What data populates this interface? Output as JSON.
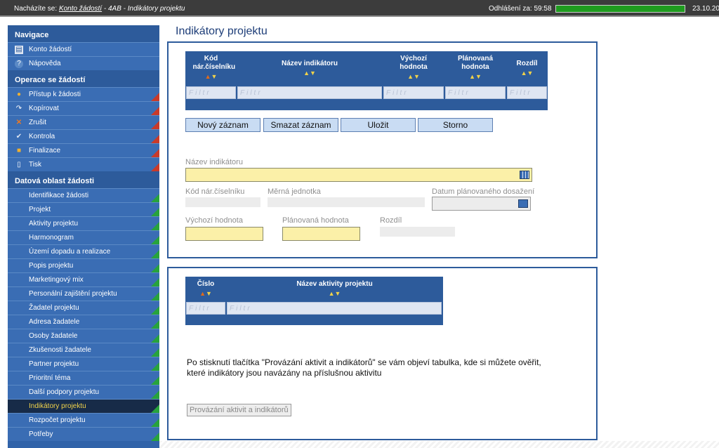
{
  "topbar": {
    "location_prefix": "Nacházíte se:",
    "crumb_link": "Konto žádostí",
    "crumb_rest": " - 4AB - Indikátory projektu",
    "logout_label": "Odhlášení za:",
    "logout_time": "59:58",
    "session_progress": 1.0,
    "date": "23.10.20"
  },
  "sidebar": {
    "sections": [
      {
        "title": "Navigace"
      },
      {
        "title": "Operace se žádostí"
      },
      {
        "title": "Datová oblast žádosti"
      }
    ],
    "nav_items": [
      {
        "label": "Konto žádostí",
        "icon": "book-icon"
      },
      {
        "label": "Nápověda",
        "icon": "help-icon"
      }
    ],
    "op_items": [
      {
        "label": "Přístup k žádosti",
        "icon": "users-icon"
      },
      {
        "label": "Kopírovat",
        "icon": "copy-arrow-icon"
      },
      {
        "label": "Zrušit",
        "icon": "cancel-icon"
      },
      {
        "label": "Kontrola",
        "icon": "check-icon"
      },
      {
        "label": "Finalizace",
        "icon": "lock-icon"
      },
      {
        "label": "Tisk",
        "icon": "document-icon"
      }
    ],
    "data_items": [
      {
        "label": "Identifikace žádosti"
      },
      {
        "label": "Projekt"
      },
      {
        "label": "Aktivity projektu"
      },
      {
        "label": "Harmonogram"
      },
      {
        "label": "Území dopadu a realizace"
      },
      {
        "label": "Popis projektu"
      },
      {
        "label": "Marketingový mix"
      },
      {
        "label": "Personální zajištění projektu"
      },
      {
        "label": "Žadatel projektu"
      },
      {
        "label": "Adresa žadatele"
      },
      {
        "label": "Osoby žadatele"
      },
      {
        "label": "Zkušenosti žadatele"
      },
      {
        "label": "Partner projektu"
      },
      {
        "label": "Prioritní téma"
      },
      {
        "label": "Další podpory projektu"
      },
      {
        "label": "Indikátory projektu",
        "active": true
      },
      {
        "label": "Rozpočet projektu"
      },
      {
        "label": "Potřeby"
      }
    ],
    "colors": {
      "accent": "#3163a9",
      "active_text": "#f0d24a"
    }
  },
  "page": {
    "title": "Indikátory projektu"
  },
  "indicators_grid": {
    "columns": [
      {
        "label": "Kód nár.číselníku"
      },
      {
        "label": "Název indikátoru"
      },
      {
        "label": "Výchozí hodnota"
      },
      {
        "label": "Plánovaná hodnota"
      },
      {
        "label": "Rozdíl"
      }
    ],
    "filter_placeholder": "Filtr"
  },
  "buttons": {
    "new": "Nový záznam",
    "delete": "Smazat záznam",
    "save": "Uložit",
    "cancel": "Storno"
  },
  "form": {
    "name_label": "Název indikátoru",
    "code_label": "Kód nár.číselníku",
    "unit_label": "Měrná jednotka",
    "date_label": "Datum plánovaného dosažení",
    "start_label": "Výchozí hodnota",
    "planned_label": "Plánovaná hodnota",
    "diff_label": "Rozdíl"
  },
  "activities_grid": {
    "columns": [
      {
        "label": "Číslo"
      },
      {
        "label": "Název aktivity projektu"
      }
    ],
    "filter_placeholder": "Filtr"
  },
  "note": "Po stisknutí tlačítka \"Provázání aktivit a indikátorů\" se vám objeví tabulka, kde si můžete ověřit, které indikátory jsou navázány na příslušnou aktivitu",
  "link_button": "Provázání aktivit a indikátorů"
}
